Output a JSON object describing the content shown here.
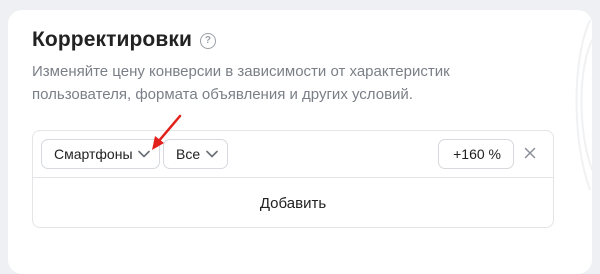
{
  "panel": {
    "title": "Корректировки",
    "help_icon": "question-circle-icon",
    "description": "Изменяйте цену конверсии в зависимости от характеристик пользователя, формата объявления и других условий."
  },
  "adjustment": {
    "device": "Смартфоны",
    "filter": "Все",
    "value": "+160 %",
    "remove_icon": "close-icon",
    "dropdown_icon": "chevron-down-icon"
  },
  "add_button": {
    "label": "Добавить"
  },
  "annotation": {
    "arrow_color": "#e3211c"
  }
}
